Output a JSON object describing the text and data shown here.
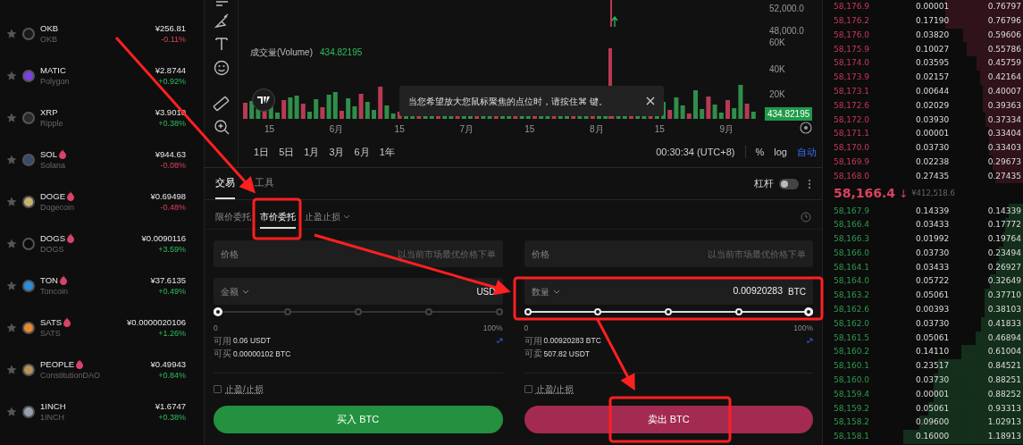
{
  "sidebar": {
    "coins": [
      {
        "symbol": "OKB",
        "name": "OKB",
        "price": "¥256.81",
        "change": "-0.11%",
        "rising": false,
        "hot": false,
        "color": "#1a1a1a"
      },
      {
        "symbol": "MATIC",
        "name": "Polygon",
        "price": "¥2.8744",
        "change": "+0.92%",
        "rising": true,
        "hot": false,
        "color": "#7b3fe4"
      },
      {
        "symbol": "XRP",
        "name": "Ripple",
        "price": "¥3.9010",
        "change": "+0.38%",
        "rising": true,
        "hot": false,
        "color": "#2a2a2a"
      },
      {
        "symbol": "SOL",
        "name": "Solana",
        "price": "¥944.63",
        "change": "-0.08%",
        "rising": false,
        "hot": true,
        "color": "#3a4a6a"
      },
      {
        "symbol": "DOGE",
        "name": "Dogecoin",
        "price": "¥0.69498",
        "change": "-0.48%",
        "rising": false,
        "hot": true,
        "color": "#c9b36a"
      },
      {
        "symbol": "DOGS",
        "name": "DOGS",
        "price": "¥0.0090116",
        "change": "+3.59%",
        "rising": true,
        "hot": true,
        "color": "#0a0a0a"
      },
      {
        "symbol": "TON",
        "name": "Toncoin",
        "price": "¥37.6135",
        "change": "+0.49%",
        "rising": true,
        "hot": true,
        "color": "#2a8fd8"
      },
      {
        "symbol": "SATS",
        "name": "SATS",
        "price": "¥0.0000020106",
        "change": "+1.26%",
        "rising": true,
        "hot": true,
        "color": "#e8892c"
      },
      {
        "symbol": "PEOPLE",
        "name": "ConstitutionDAO",
        "price": "¥0.49943",
        "change": "+0.84%",
        "rising": true,
        "hot": true,
        "color": "#b8925a"
      },
      {
        "symbol": "1INCH",
        "name": "1INCH",
        "price": "¥1.6747",
        "change": "+0.38%",
        "rising": true,
        "hot": false,
        "color": "#9aa0b0"
      }
    ]
  },
  "chart": {
    "price_axis": [
      "52,000.0",
      "48,000.0"
    ],
    "volume_axis": [
      "60K",
      "40K",
      "20K"
    ],
    "volume_legend": {
      "label": "成交量(Volume)",
      "value": "434.82195"
    },
    "volume_tag": "434.82195",
    "tooltip": "当您希望放大您鼠标聚焦的点位时，请按住⌘ 键。",
    "x_labels": [
      "15",
      "6月",
      "15",
      "7月",
      "15",
      "8月",
      "15",
      "9月"
    ],
    "timeframes": [
      "1日",
      "5日",
      "1月",
      "3月",
      "6月",
      "1年"
    ],
    "clock": "00:30:34 (UTC+8)",
    "scale_options": [
      {
        "label": "%",
        "selected": false
      },
      {
        "label": "log",
        "selected": false
      },
      {
        "label": "自动",
        "selected": true
      }
    ]
  },
  "trade": {
    "tabs": [
      {
        "label": "交易",
        "selected": true
      },
      {
        "label": "工具",
        "selected": false
      }
    ],
    "leverage": {
      "label": "杠杆",
      "on": false
    },
    "order_types": [
      {
        "label": "限价委托",
        "selected": false
      },
      {
        "label": "市价委托",
        "selected": true
      },
      {
        "label": "止盈止损",
        "selected": false
      }
    ],
    "buy": {
      "price_label": "价格",
      "price_placeholder": "以当前市场最优价格下单",
      "amount_label": "金额",
      "unit": "USD",
      "level": 0,
      "min_label": "0",
      "max_label": "100%",
      "available_label": "可用",
      "available": "0.06 USDT",
      "max_label2": "可买",
      "max_value": "0.00000102 BTC",
      "tp_sl": {
        "label": "止盈/止损",
        "checked": false
      },
      "button": "买入 BTC"
    },
    "sell": {
      "price_label": "价格",
      "price_placeholder": "以当前市场最优价格下单",
      "amount_label": "数量",
      "amount_value": "0.00920283",
      "unit": "BTC",
      "level": 1,
      "min_label": "0",
      "max_label": "100%",
      "available_label": "可用",
      "available": "0.00920283 BTC",
      "max_label2": "可卖",
      "max_value": "507.82 USDT",
      "tp_sl": {
        "label": "止盈/止损",
        "checked": false
      },
      "button": "卖出 BTC"
    }
  },
  "order_book": {
    "asks": [
      [
        "58,176.9",
        "0.00001",
        "0.76797"
      ],
      [
        "58,176.2",
        "0.17190",
        "0.76796"
      ],
      [
        "58,176.0",
        "0.03820",
        "0.59606"
      ],
      [
        "58,175.9",
        "0.10027",
        "0.55786"
      ],
      [
        "58,174.0",
        "0.03595",
        "0.45759"
      ],
      [
        "58,173.9",
        "0.02157",
        "0.42164"
      ],
      [
        "58,173.1",
        "0.00644",
        "0.40007"
      ],
      [
        "58,172.6",
        "0.02029",
        "0.39363"
      ],
      [
        "58,172.0",
        "0.03930",
        "0.37334"
      ],
      [
        "58,171.1",
        "0.00001",
        "0.33404"
      ],
      [
        "58,170.0",
        "0.03730",
        "0.33403"
      ],
      [
        "58,169.9",
        "0.02238",
        "0.29673"
      ],
      [
        "58,168.0",
        "0.27435",
        "0.27435"
      ]
    ],
    "last_price": "58,166.4",
    "last_arrow": "↓",
    "last_fiat": "¥412,518.6",
    "bids": [
      [
        "58,167.9",
        "0.14339",
        "0.14339"
      ],
      [
        "58,166.4",
        "0.03433",
        "0.17772"
      ],
      [
        "58,166.3",
        "0.01992",
        "0.19764"
      ],
      [
        "58,166.0",
        "0.03730",
        "0.23494"
      ],
      [
        "58,164.1",
        "0.03433",
        "0.26927"
      ],
      [
        "58,164.0",
        "0.05722",
        "0.32649"
      ],
      [
        "58,163.2",
        "0.05061",
        "0.37710"
      ],
      [
        "58,162.6",
        "0.00393",
        "0.38103"
      ],
      [
        "58,162.0",
        "0.03730",
        "0.41833"
      ],
      [
        "58,161.5",
        "0.05061",
        "0.46894"
      ],
      [
        "58,160.2",
        "0.14110",
        "0.61004"
      ],
      [
        "58,160.1",
        "0.23517",
        "0.84521"
      ],
      [
        "58,160.0",
        "0.03730",
        "0.88251"
      ],
      [
        "58,159.4",
        "0.00001",
        "0.88252"
      ],
      [
        "58,159.2",
        "0.05061",
        "0.93313"
      ],
      [
        "58,158.2",
        "0.09600",
        "1.02913"
      ],
      [
        "58,158.1",
        "0.16000",
        "1.18913"
      ]
    ]
  }
}
